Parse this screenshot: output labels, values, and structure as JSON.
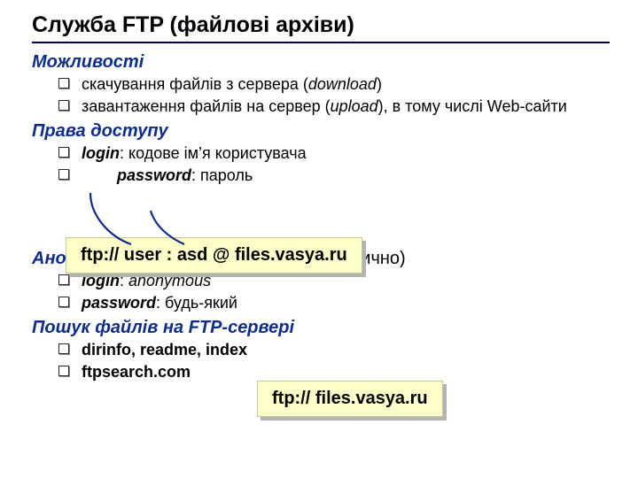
{
  "title": "Служба FTP (файлові архіви)",
  "sections": {
    "capabilities": {
      "heading": "Можливості",
      "items": [
        {
          "pre": "скачування файлів з сервера (",
          "ital": "download",
          "post": ")"
        },
        {
          "pre": "завантаження файлів на сервер (",
          "ital": "upload",
          "post": "), в тому числі Web-сайти"
        }
      ]
    },
    "access": {
      "heading": "Права доступу",
      "items": [
        {
          "bold": "login",
          "rest": ": кодове ім’я користувача"
        },
        {
          "indent_bold": "password",
          "rest": ": пароль"
        }
      ]
    },
    "anon": {
      "heading": "Анонімний вхід",
      "tail": " (в браузерах - автоматично)",
      "items": [
        {
          "bold": "login",
          "rest": ": ",
          "ital_rest": "anonymous"
        },
        {
          "bold": "password",
          "rest": ": будь-який"
        }
      ]
    },
    "search": {
      "heading": "Пошук файлів на FTP-сервері",
      "items": [
        {
          "bold": "dirinfo, readme, index"
        },
        {
          "bold": "ftpsearch.com"
        }
      ]
    }
  },
  "callouts": {
    "c1": "ftp:// user : asd @ files.vasya.ru",
    "c2": "ftp:// files.vasya.ru"
  }
}
